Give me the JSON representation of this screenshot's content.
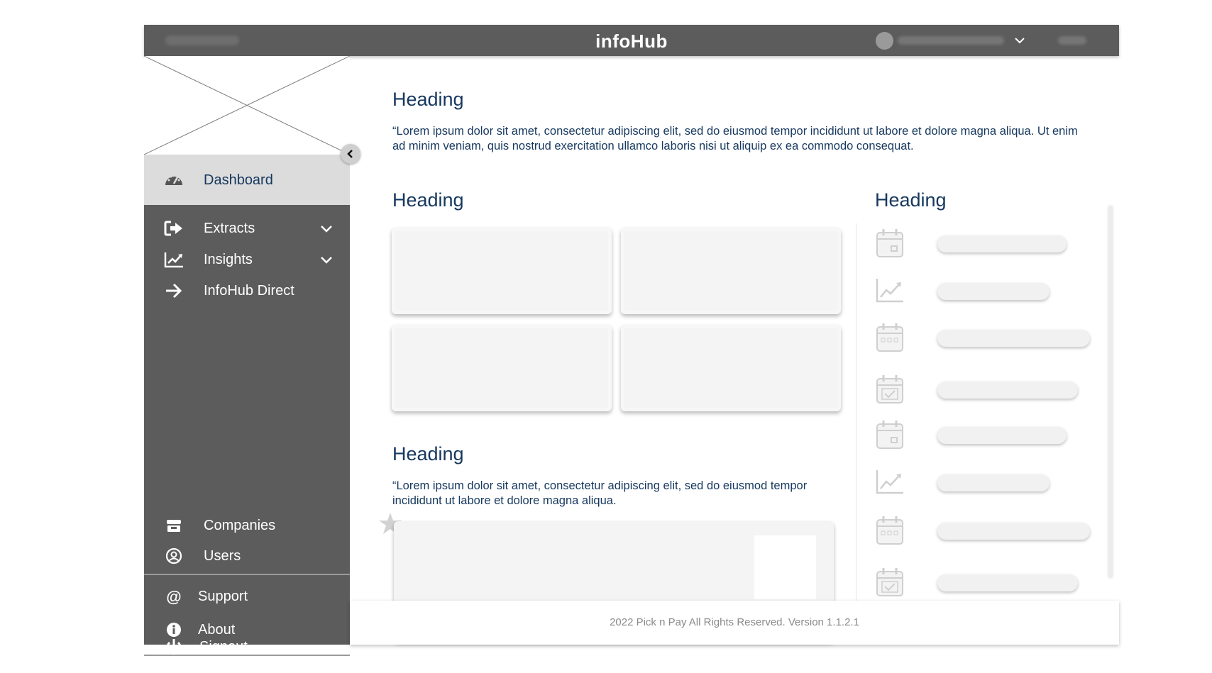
{
  "app": {
    "title": "infoHub",
    "version_label_blurred": "Version 1.1.2.1",
    "user_name_blurred": "Company/User Name",
    "help_label_blurred": "Help"
  },
  "sidebar": {
    "primary_items": [
      {
        "label": "Dashboard",
        "icon": "speedometer-icon",
        "active": true
      },
      {
        "label": "Extracts",
        "icon": "sign-out-arrow-icon",
        "expandable": true
      },
      {
        "label": "Insights",
        "icon": "line-chart-icon",
        "expandable": true
      },
      {
        "label": "InfoHub Direct",
        "icon": "arrow-right-icon"
      }
    ],
    "admin_items": [
      {
        "label": "Companies",
        "icon": "store-icon"
      },
      {
        "label": "Users",
        "icon": "user-circle-icon"
      }
    ],
    "help_items": [
      {
        "label": "Support",
        "icon": "at-icon"
      },
      {
        "label": "About",
        "icon": "info-icon"
      }
    ],
    "signout": {
      "label": "Signout",
      "icon": "power-icon"
    }
  },
  "main": {
    "intro": {
      "heading": "Heading",
      "text": "“Lorem ipsum dolor sit amet, consectetur adipiscing elit, sed do eiusmod tempor incididunt ut labore et dolore magna aliqua. Ut enim ad minim veniam, quis nostrud exercitation ullamco laboris nisi ut aliquip ex ea commodo consequat."
    },
    "cards_section": {
      "heading": "Heading"
    },
    "second_section": {
      "heading": "Heading",
      "text": "“Lorem ipsum dolor sit amet, consectetur adipiscing elit, sed do eiusmod tempor incididunt ut labore et dolore magna aliqua."
    },
    "right_list": {
      "heading": "Heading",
      "items": [
        {
          "icon": "calendar-icon"
        },
        {
          "icon": "chart-icon"
        },
        {
          "icon": "calendar-grid-icon"
        },
        {
          "icon": "calendar-check-icon"
        },
        {
          "icon": "calendar-icon"
        },
        {
          "icon": "chart-icon"
        },
        {
          "icon": "calendar-grid-icon"
        },
        {
          "icon": "calendar-check-icon"
        }
      ]
    }
  },
  "footer": {
    "text": "2022 Pick n Pay All Rights Reserved. Version 1.1.2.1"
  },
  "colors": {
    "topbar": "#5c5c5c",
    "sidebar": "#5c5c5c",
    "active_nav": "#dcdcdc",
    "heading": "#16385e",
    "card": "#f4f4f4"
  }
}
